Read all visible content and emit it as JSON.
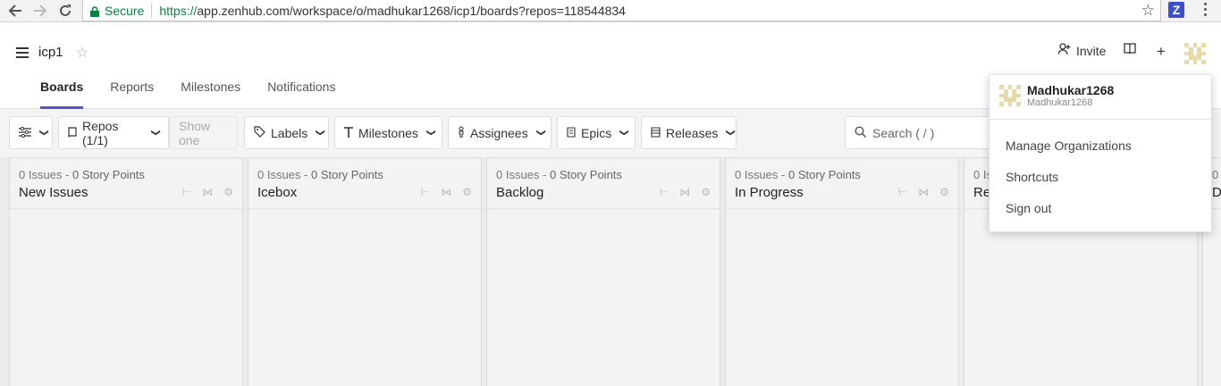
{
  "browser": {
    "secure_label": "Secure",
    "url_scheme": "https://",
    "url_rest": "app.zenhub.com/workspace/o/madhukar1268/icp1/boards?repos=118544834",
    "extension_label": "Z"
  },
  "header": {
    "workspace_name": "icp1",
    "invite_label": "Invite",
    "tabs": [
      {
        "label": "Boards",
        "active": true
      },
      {
        "label": "Reports",
        "active": false
      },
      {
        "label": "Milestones",
        "active": false
      },
      {
        "label": "Notifications",
        "active": false
      }
    ]
  },
  "toolbar": {
    "repos_label": "Repos (1/1)",
    "show_one_label": "Show one",
    "labels_label": "Labels",
    "milestones_label": "Milestones",
    "assignees_label": "Assignees",
    "epics_label": "Epics",
    "releases_label": "Releases",
    "search_placeholder": "Search ( / )"
  },
  "columns": [
    {
      "issues": "0 Issues",
      "points": "0 Story Points",
      "title": "New Issues"
    },
    {
      "issues": "0 Issues",
      "points": "0 Story Points",
      "title": "Icebox"
    },
    {
      "issues": "0 Issues",
      "points": "0 Story Points",
      "title": "Backlog"
    },
    {
      "issues": "0 Issues",
      "points": "0 Story Points",
      "title": "In Progress"
    },
    {
      "issues": "0 Is",
      "points": "",
      "title": "Re"
    },
    {
      "issues": "0",
      "points": "",
      "title": "D"
    }
  ],
  "dropdown": {
    "user_name": "Madhukar1268",
    "user_login": "Madhukar1268",
    "items": [
      "Manage Organizations",
      "Shortcuts",
      "Sign out"
    ]
  },
  "colors": {
    "accent": "#5a4fcf",
    "secure_green": "#0b8043",
    "avatar": "#e8d9a8"
  }
}
